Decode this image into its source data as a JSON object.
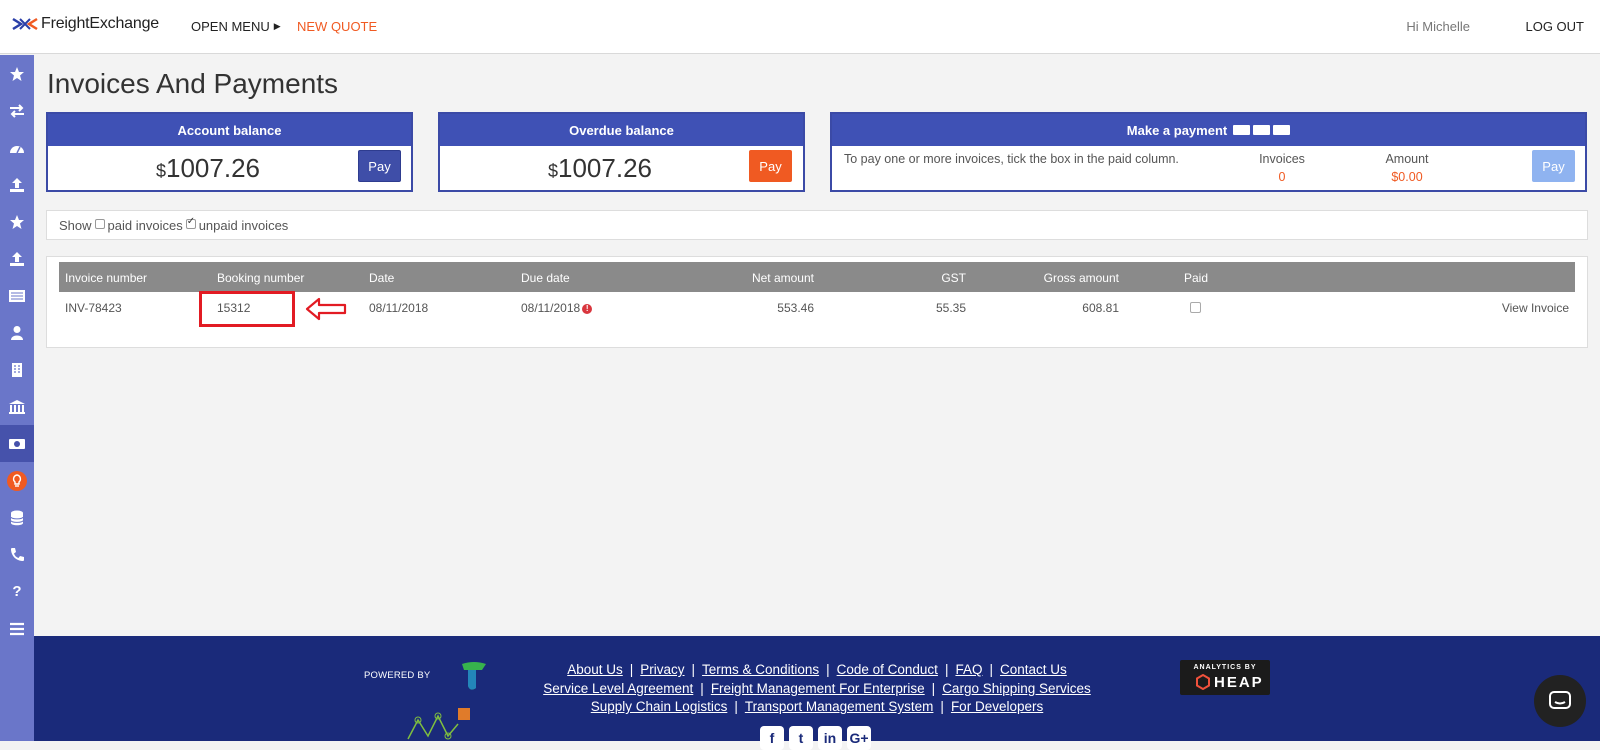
{
  "header": {
    "brand": "FreightExchange",
    "open_menu": "OPEN MENU",
    "new_quote": "NEW QUOTE",
    "greeting": "Hi Michelle",
    "logout": "LOG OUT"
  },
  "sidebar": {
    "icons": [
      "star-icon",
      "exchange-icon",
      "dashboard-icon",
      "upload-icon",
      "star-icon",
      "upload-icon",
      "list-icon",
      "user-icon",
      "building-icon",
      "bank-icon",
      "money-icon",
      "lightbulb-icon",
      "database-icon",
      "phone-icon",
      "question-icon",
      "menu-icon"
    ],
    "active_index": 10
  },
  "page": {
    "title": "Invoices And Payments"
  },
  "account_balance": {
    "title": "Account balance",
    "currency": "$",
    "amount": "1007.26",
    "button": "Pay"
  },
  "overdue_balance": {
    "title": "Overdue balance",
    "currency": "$",
    "amount": "1007.26",
    "button": "Pay"
  },
  "make_payment": {
    "title": "Make a payment",
    "description": "To pay one or more invoices, tick the box in the paid column.",
    "invoices_label": "Invoices",
    "invoices_value": "0",
    "amount_label": "Amount",
    "amount_value": "$0.00",
    "button": "Pay"
  },
  "filter": {
    "show": "Show",
    "paid": "paid invoices",
    "paid_checked": false,
    "unpaid": "unpaid invoices",
    "unpaid_checked": true
  },
  "table": {
    "headers": [
      "Invoice number",
      "Booking number",
      "Date",
      "Due date",
      "Net amount",
      "GST",
      "Gross amount",
      "Paid"
    ],
    "rows": [
      {
        "invoice_number": "INV-78423",
        "booking_number": "15312",
        "date": "08/11/2018",
        "due_date": "08/11/2018",
        "overdue": true,
        "net_amount": "553.46",
        "gst": "55.35",
        "gross_amount": "608.81",
        "paid": false,
        "action": "View Invoice"
      }
    ]
  },
  "footer": {
    "powered_by": "POWERED BY",
    "links_line1": [
      "About Us",
      "Privacy",
      "Terms & Conditions",
      "Code of Conduct",
      "FAQ",
      "Contact Us"
    ],
    "links_line2": [
      "Service Level Agreement",
      "Freight Management For Enterprise",
      "Cargo Shipping Services"
    ],
    "links_line3": [
      "Supply Chain Logistics",
      "Transport Management System",
      "For Developers"
    ],
    "heap_top": "ANALYTICS BY",
    "heap_name": "HEAP",
    "social": [
      "f",
      "t",
      "in",
      "G+"
    ]
  },
  "colors": {
    "brand_blue": "#3f51b5",
    "accent_orange": "#f05a22",
    "sidebar": "#6a76c9",
    "footer": "#1a2a7a",
    "highlight_red": "#e21b23"
  }
}
